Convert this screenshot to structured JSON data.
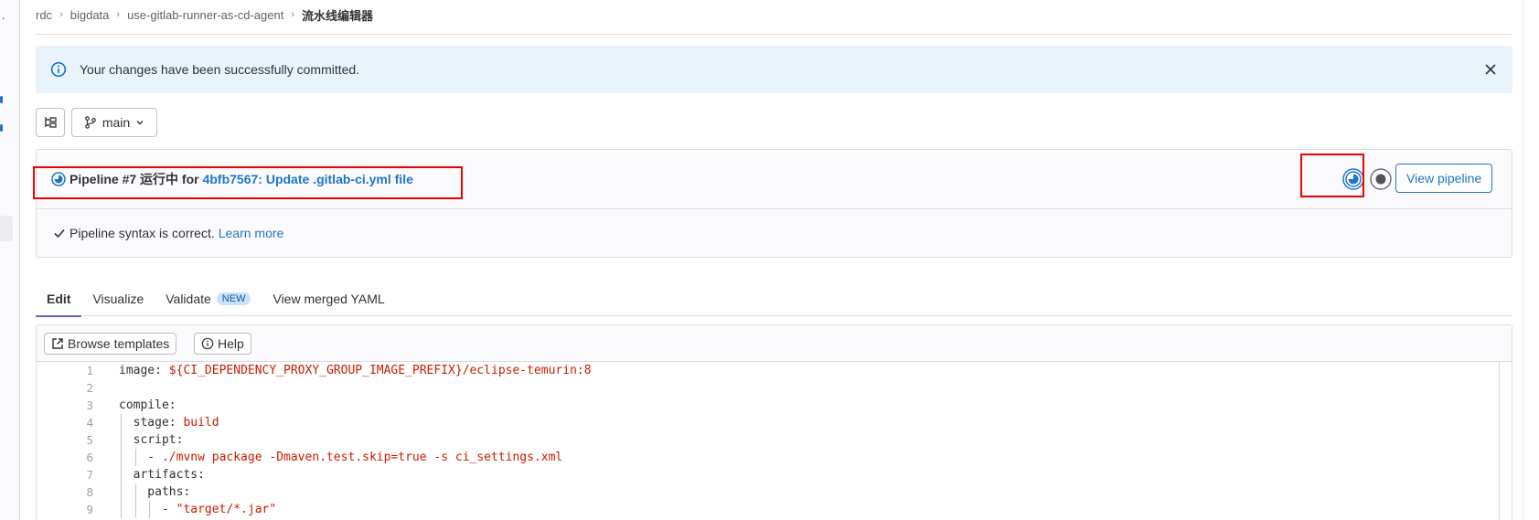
{
  "breadcrumb": {
    "items": [
      "rdc",
      "bigdata",
      "use-gitlab-runner-as-cd-agent"
    ],
    "current": "流水线编辑器"
  },
  "alert": {
    "message": "Your changes have been successfully committed."
  },
  "toolbar": {
    "branch": "main"
  },
  "pipeline": {
    "title_prefix": "Pipeline #7 运行中 for",
    "commit_link": "4bfb7567: Update .gitlab-ci.yml file",
    "view_button": "View pipeline",
    "syntax_message": "Pipeline syntax is correct.",
    "learn_more": "Learn more"
  },
  "tabs": [
    {
      "label": "Edit"
    },
    {
      "label": "Visualize"
    },
    {
      "label": "Validate",
      "badge": "NEW"
    },
    {
      "label": "View merged YAML"
    }
  ],
  "editor": {
    "browse_templates": "Browse templates",
    "help": "Help",
    "lines": [
      {
        "n": "1",
        "key": "image: ",
        "val": "${CI_DEPENDENCY_PROXY_GROUP_IMAGE_PREFIX}/eclipse-temurin:8",
        "depth": 0
      },
      {
        "n": "2",
        "key": "",
        "val": "",
        "depth": 0
      },
      {
        "n": "3",
        "key": "compile:",
        "val": "",
        "depth": 0
      },
      {
        "n": "4",
        "key": "  stage: ",
        "val": "build",
        "depth": 1
      },
      {
        "n": "5",
        "key": "  script:",
        "val": "",
        "depth": 1
      },
      {
        "n": "6",
        "key": "    - ",
        "val": "./mvnw package -Dmaven.test.skip=true -s ci_settings.xml",
        "depth": 2
      },
      {
        "n": "7",
        "key": "  artifacts:",
        "val": "",
        "depth": 1
      },
      {
        "n": "8",
        "key": "    paths:",
        "val": "",
        "depth": 2
      },
      {
        "n": "9",
        "key": "      - ",
        "val": "\"target/*.jar\"",
        "depth": 3
      }
    ]
  },
  "colors": {
    "link": "#1f75cb",
    "alert_bg": "#e9f3fc",
    "string": "#c91c00",
    "annotation": "#ee0000"
  }
}
